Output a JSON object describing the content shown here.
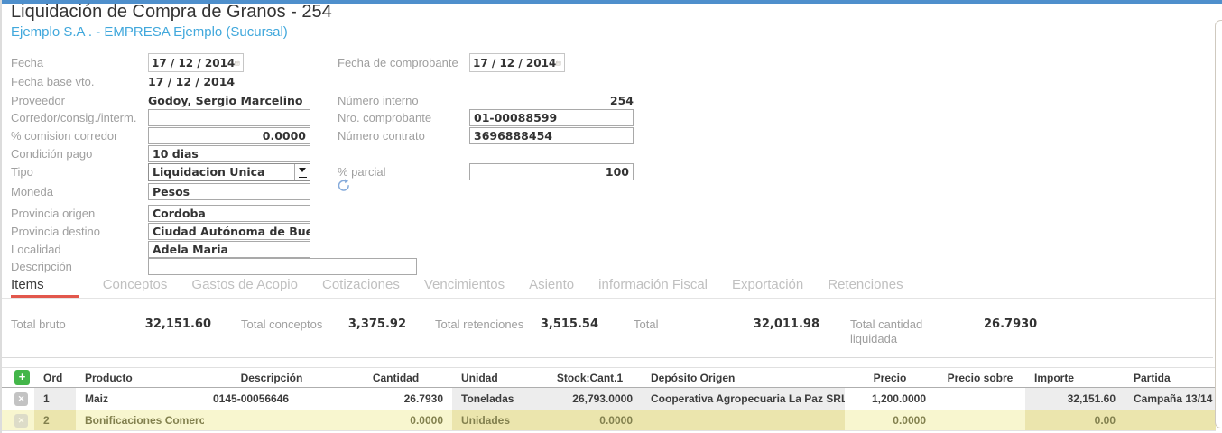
{
  "colors": {
    "topbar": "#4e8fcc",
    "link": "#41a8dc",
    "tabline": "#e2574c",
    "addGreen": "#43b649",
    "hlLight": "#f8f6cf",
    "hlDark": "#ebe5ad"
  },
  "header": {
    "title": "Liquidación de Compra de Granos - 254",
    "subtitle": "Ejemplo S.A . - EMPRESA Ejemplo (Sucursal)"
  },
  "icons": {
    "add_row": {
      "name": "add-row-icon",
      "glyph": "+"
    },
    "delete_row": {
      "name": "delete-row-icon",
      "glyph": "✕"
    },
    "calendar": {
      "name": "calendar-icon",
      "glyph": "▦"
    },
    "dropdown": {
      "name": "chevron-down-icon",
      "glyph": "▼"
    },
    "refresh": {
      "name": "refresh-icon",
      "glyph": "⟳"
    }
  },
  "form": {
    "fields": [
      {
        "id": "fecha",
        "col": "left",
        "label": "Fecha",
        "type": "date",
        "value": "17 / 12 / 2014"
      },
      {
        "id": "fecha_base_vto",
        "col": "left",
        "label": "Fecha base vto.",
        "type": "static",
        "value": "17 / 12 / 2014"
      },
      {
        "id": "proveedor",
        "col": "left",
        "label": "Proveedor",
        "type": "static",
        "value": "Godoy, Sergio Marcelino"
      },
      {
        "id": "corredor",
        "col": "left",
        "label": "Corredor/consig./interm.",
        "type": "input",
        "value": ""
      },
      {
        "id": "comision_corredor",
        "col": "left",
        "label": "% comision corredor",
        "type": "input",
        "value": "0.0000",
        "align": "right"
      },
      {
        "id": "condicion_pago",
        "col": "left",
        "label": "Condición pago",
        "type": "input",
        "value": "10 dias"
      },
      {
        "id": "tipo",
        "col": "left",
        "label": "Tipo",
        "type": "select",
        "value": "Liquidacion Unica"
      },
      {
        "id": "moneda",
        "col": "left",
        "label": "Moneda",
        "type": "input",
        "value": "Pesos"
      },
      {
        "id": "provincia_origen",
        "col": "left",
        "label": "Provincia origen",
        "type": "input",
        "value": "Cordoba"
      },
      {
        "id": "provincia_destino",
        "col": "left",
        "label": "Provincia destino",
        "type": "input",
        "value": "Ciudad Autónoma de Buenc"
      },
      {
        "id": "localidad",
        "col": "left",
        "label": "Localidad",
        "type": "input",
        "value": "Adela Maria"
      },
      {
        "id": "descripcion",
        "col": "left",
        "label": "Descripción",
        "type": "input",
        "value": "",
        "wide": true
      },
      {
        "id": "fecha_comprobante",
        "col": "right",
        "label": "Fecha de comprobante",
        "type": "date",
        "value": "17 / 12 / 2014"
      },
      {
        "id": "numero_interno",
        "col": "right",
        "label": "Número interno",
        "type": "static",
        "value": "254",
        "align": "right"
      },
      {
        "id": "nro_comprobante",
        "col": "right",
        "label": "Nro. comprobante",
        "type": "input",
        "value": "01-00088599"
      },
      {
        "id": "numero_contrato",
        "col": "right",
        "label": "Número contrato",
        "type": "input",
        "value": "3696888454"
      },
      {
        "id": "parcial",
        "col": "right",
        "label": "% parcial",
        "type": "input",
        "value": "100",
        "align": "right"
      }
    ]
  },
  "tabs": {
    "active_index": 0,
    "items": [
      "Items",
      "Conceptos",
      "Gastos de Acopio",
      "Cotizaciones",
      "Vencimientos",
      "Asiento",
      "información Fiscal",
      "Exportación",
      "Retenciones"
    ]
  },
  "totals": [
    {
      "label": "Total bruto",
      "value": "32,151.60"
    },
    {
      "label": "Total conceptos",
      "value": "3,375.92"
    },
    {
      "label": "Total retenciones",
      "value": "3,515.54"
    },
    {
      "label": "Total",
      "value": "32,011.98"
    },
    {
      "label": "Total cantidad liquidada",
      "value": "26.7930"
    }
  ],
  "table": {
    "headers": [
      "Ord",
      "Producto",
      "Descripción",
      "Cantidad",
      "Unidad",
      "Stock:Cant.1",
      "Depósito Origen",
      "Precio",
      "Precio sobre",
      "Importe",
      "Partida"
    ],
    "rows": [
      {
        "ord": "1",
        "producto": "Maiz",
        "descripcion": "0145-00056646",
        "cantidad": "26.7930",
        "unidad": "Toneladas",
        "stock": "26,793.0000",
        "deposito": "Cooperativa Agropecuaria La Paz SRL",
        "precio": "1,200.0000",
        "precio_sobre": "",
        "importe": "32,151.60",
        "partida": "Campaña 13/14",
        "highlight": false
      },
      {
        "ord": "2",
        "producto": "Bonificaciones Comerciales de Granos",
        "descripcion": "",
        "cantidad": "0.0000",
        "unidad": "Unidades",
        "stock": "0.0000",
        "deposito": "",
        "precio": "0.0000",
        "precio_sobre": "",
        "importe": "0.00",
        "partida": "",
        "highlight": true
      }
    ]
  }
}
